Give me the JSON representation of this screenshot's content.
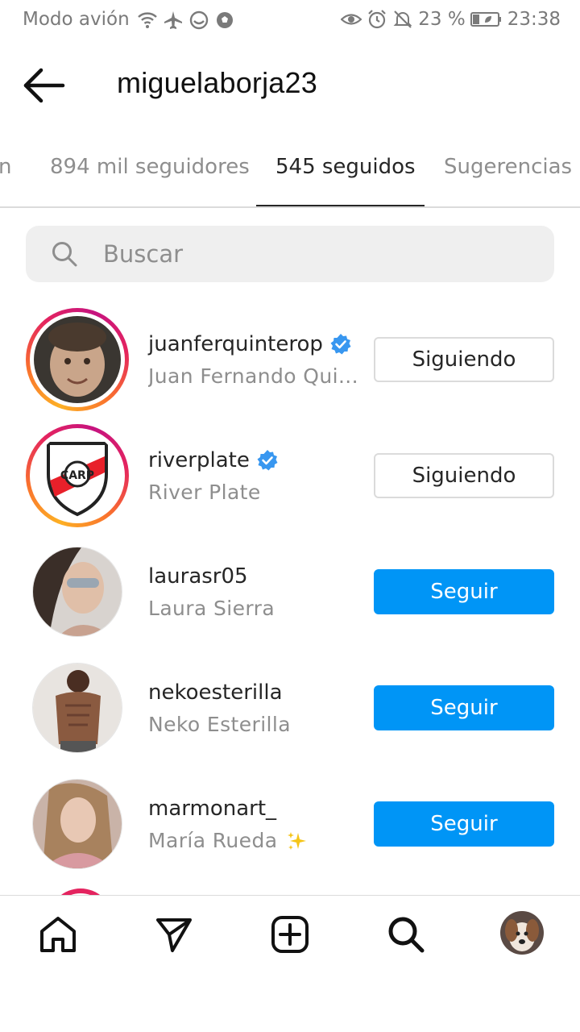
{
  "status_bar": {
    "left_text": "Modo avión",
    "battery_text": "23 %",
    "time": "23:38",
    "icons_left": [
      "wifi-icon",
      "airplane-icon",
      "sync-icon",
      "soccer-icon"
    ],
    "icons_right": [
      "eye-icon",
      "alarm-icon",
      "mute-icon",
      "battery-icon"
    ]
  },
  "header": {
    "title": "miguelaborja23"
  },
  "tabs": [
    {
      "label": "n"
    },
    {
      "label": "894 mil seguidores"
    },
    {
      "label": "545 seguidos",
      "active": true
    },
    {
      "label": "Sugerencias"
    }
  ],
  "search": {
    "placeholder": "Buscar"
  },
  "users": [
    {
      "username": "juanferquinterop",
      "fullname": "Juan Fernando Qui...",
      "verified": true,
      "button": "Siguiendo",
      "story": true
    },
    {
      "username": "riverplate",
      "fullname": "River Plate",
      "verified": true,
      "button": "Siguiendo",
      "story": true
    },
    {
      "username": "laurasr05",
      "fullname": "Laura Sierra",
      "verified": false,
      "button": "Seguir",
      "story": false
    },
    {
      "username": "nekoesterilla",
      "fullname": "Neko Esterilla",
      "verified": false,
      "button": "Seguir",
      "story": false
    },
    {
      "username": "marmonart_",
      "fullname": "María Rueda",
      "verified": false,
      "button": "Seguir",
      "story": false
    }
  ],
  "colors": {
    "accent": "#0095f6",
    "verified": "#3897f0",
    "secondary_text": "#8e8e8e"
  },
  "bottom_nav": [
    "home-icon",
    "direct-icon",
    "new-post-icon",
    "search-icon",
    "profile-avatar"
  ]
}
